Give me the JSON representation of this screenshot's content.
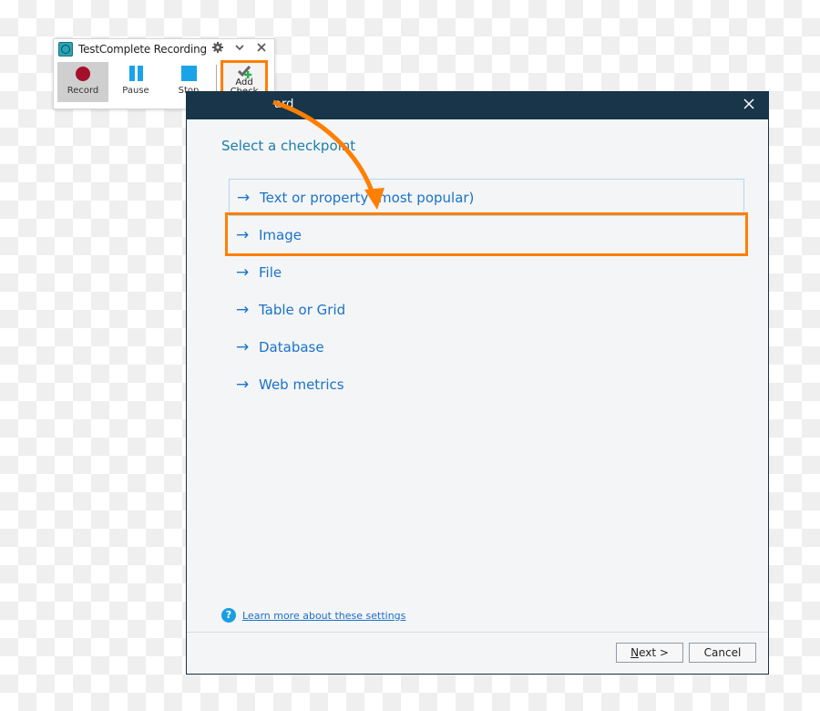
{
  "recorder": {
    "title": "TestComplete Recording",
    "controls": {
      "settings_icon": "gear-icon",
      "collapse_icon": "chevron-down-icon",
      "close_icon": "close-icon"
    },
    "buttons": [
      {
        "label": "Record",
        "icon": "record-icon",
        "active": true
      },
      {
        "label": "Pause",
        "icon": "pause-icon",
        "active": false
      },
      {
        "label": "Stop",
        "icon": "stop-icon",
        "active": false
      }
    ],
    "add_check": {
      "line1": "Add",
      "line2": "Check",
      "icon": "checkmark-plus-icon",
      "highlighted": true
    }
  },
  "dialog": {
    "title_visible": "ard",
    "close_icon": "close-icon",
    "heading": "Select a checkpoint",
    "options": [
      {
        "label": "Text or property (most popular)",
        "icon": "arrow-right-icon"
      },
      {
        "label": "Image",
        "icon": "arrow-right-icon",
        "highlighted": true
      },
      {
        "label": "File",
        "icon": "arrow-right-icon"
      },
      {
        "label": "Table or Grid",
        "icon": "arrow-right-icon"
      },
      {
        "label": "Database",
        "icon": "arrow-right-icon"
      },
      {
        "label": "Web metrics",
        "icon": "arrow-right-icon"
      }
    ],
    "help": {
      "icon": "help-icon",
      "glyph": "?",
      "link": "Learn more about these settings"
    },
    "buttons": {
      "next_accel": "N",
      "next_rest": "ext >",
      "cancel": "Cancel"
    }
  },
  "annotation": {
    "color": "#ff7f00",
    "from": "add-check-button",
    "to": "option-image"
  }
}
